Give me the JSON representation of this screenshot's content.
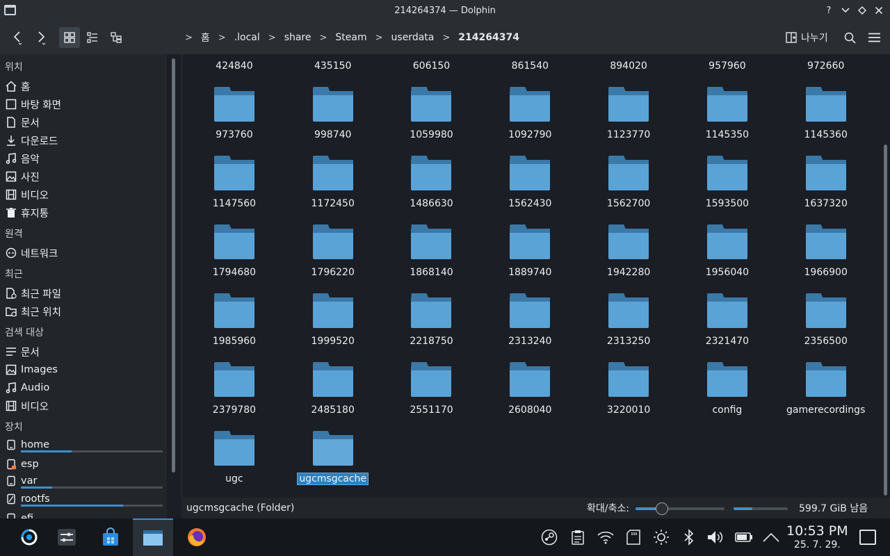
{
  "window": {
    "title": "214264374 — Dolphin",
    "help_glyph": "?",
    "min_glyph": "⌄",
    "max_glyph": "◇",
    "close_glyph": "✕"
  },
  "toolbar": {
    "back_icon": "chevron-left-icon",
    "forward_icon": "chevron-right-icon",
    "breadcrumbs": [
      "홈",
      ".local",
      "share",
      "Steam",
      "userdata",
      "214264374"
    ],
    "split_label": "나누기"
  },
  "sidebar": {
    "sections": {
      "places": "위치",
      "remote": "원격",
      "recent": "최근",
      "search": "검색 대상",
      "devices": "장치"
    },
    "places": [
      "홈",
      "바탕 화면",
      "문서",
      "다운로드",
      "음악",
      "사진",
      "비디오",
      "휴지통"
    ],
    "remote": [
      "네트워크"
    ],
    "recent": [
      "최근 파일",
      "최근 위치"
    ],
    "search": [
      "문서",
      "Images",
      "Audio",
      "비디오"
    ],
    "devices": [
      {
        "label": "home",
        "used": 0.36
      },
      {
        "label": "esp",
        "used": 0
      },
      {
        "label": "var",
        "used": 0.22
      },
      {
        "label": "rootfs",
        "used": 0.72
      },
      {
        "label": "efi",
        "used": 0
      }
    ]
  },
  "files": [
    "424840",
    "435150",
    "606150",
    "861540",
    "894020",
    "957960",
    "972660",
    "973760",
    "998740",
    "1059980",
    "1092790",
    "1123770",
    "1145350",
    "1145360",
    "1147560",
    "1172450",
    "1486630",
    "1562430",
    "1562700",
    "1593500",
    "1637320",
    "1794680",
    "1796220",
    "1868140",
    "1889740",
    "1942280",
    "1956040",
    "1966900",
    "1985960",
    "1999520",
    "2218750",
    "2313240",
    "2313250",
    "2321470",
    "2356500",
    "2379780",
    "2485180",
    "2551170",
    "2608040",
    "3220010",
    "config",
    "gamerecordings",
    "ugc",
    "ugcmsgcache"
  ],
  "selected_file": "ugcmsgcache",
  "statusbar": {
    "status_text": "ugcmsgcache (Folder)",
    "zoom_label": "확대/축소:",
    "zoom_level": 0.3,
    "space_used": 0.35,
    "free_text": "599.7 GiB 남음"
  },
  "taskbar": {
    "time": "10:53 PM",
    "date": "25. 7. 29."
  },
  "colors": {
    "accent": "#3b8fd0",
    "folder_front": "#5aa3d6",
    "folder_back": "#3a79a8"
  }
}
